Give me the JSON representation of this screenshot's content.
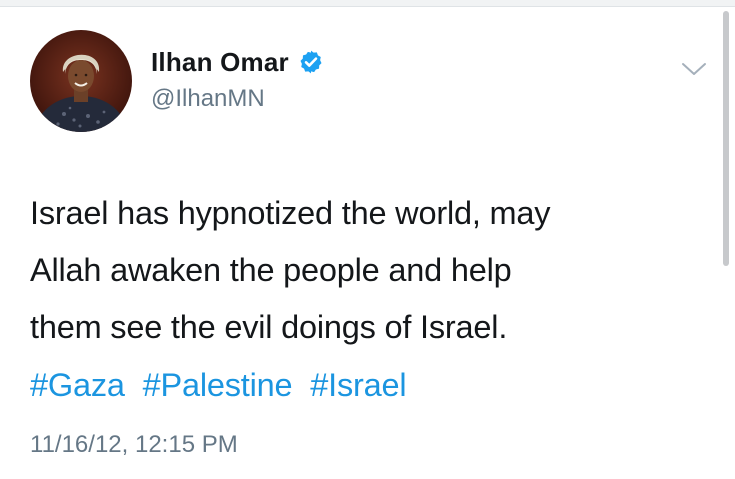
{
  "tweet": {
    "author": {
      "display_name": "Ilhan Omar",
      "handle": "@IlhanMN",
      "verified": true
    },
    "text_lines": [
      "Israel has hypnotized the world, may",
      "Allah awaken the people and help",
      "them see the evil doings of Israel."
    ],
    "hashtags": [
      "#Gaza",
      "#Palestine",
      "#Israel"
    ],
    "timestamp": "11/16/12, 12:15 PM"
  },
  "colors": {
    "text": "#14171a",
    "secondary": "#657786",
    "link": "#1b95e0",
    "verified_badge": "#1da1f2"
  },
  "icons": {
    "verified": "verified-badge-icon",
    "more": "chevron-down-icon"
  }
}
